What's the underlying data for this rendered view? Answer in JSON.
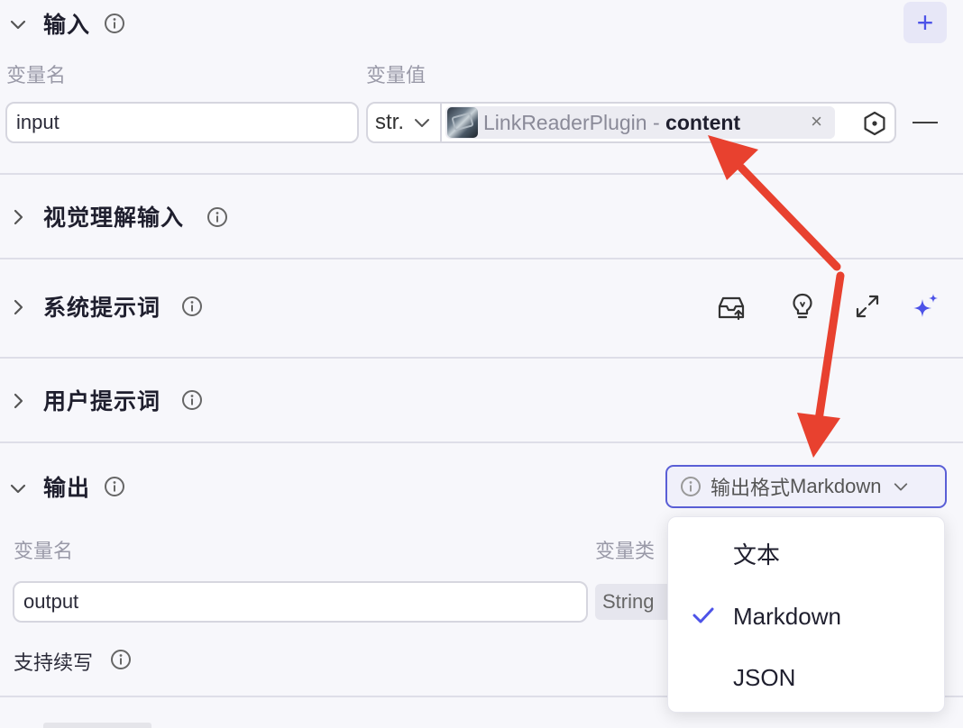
{
  "input_section": {
    "title": "输入",
    "col_name": "变量名",
    "col_value": "变量值",
    "var_name": "input",
    "type_short": "str.",
    "ref_plugin": "LinkReaderPlugin",
    "ref_sep": " - ",
    "ref_field": "content",
    "clear_glyph": "×",
    "remove_glyph": "—",
    "add_glyph": "+"
  },
  "vision_section": {
    "title": "视觉理解输入"
  },
  "system_prompt_section": {
    "title": "系统提示词"
  },
  "user_prompt_section": {
    "title": "用户提示词"
  },
  "output_section": {
    "title": "输出",
    "format_label": "输出格式",
    "format_value": "Markdown",
    "col_name": "变量名",
    "col_type_partial": "变量类",
    "var_name": "output",
    "type_value": "String",
    "continue_label": "支持续写"
  },
  "format_menu": {
    "options": [
      {
        "label": "文本",
        "selected": false
      },
      {
        "label": "Markdown",
        "selected": true
      },
      {
        "label": "JSON",
        "selected": false
      }
    ]
  },
  "colors": {
    "accent": "#4d53e8",
    "arrow": "#e8412f",
    "divider": "#dedee8"
  }
}
